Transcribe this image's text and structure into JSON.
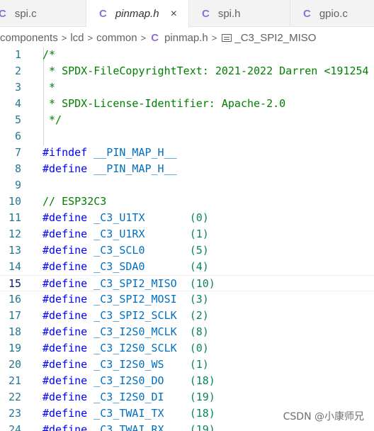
{
  "tabs": [
    {
      "icon": "C",
      "label": "spi.c",
      "active": false,
      "italic": false
    },
    {
      "icon": "C",
      "label": "pinmap.h",
      "active": true,
      "italic": true,
      "close": "×"
    },
    {
      "icon": "C",
      "label": "spi.h",
      "active": false,
      "italic": false
    },
    {
      "icon": "C",
      "label": "gpio.c",
      "active": false,
      "italic": false
    }
  ],
  "breadcrumb": {
    "parts": [
      "components",
      "lcd",
      "common"
    ],
    "file_icon": "C",
    "file": "pinmap.h",
    "symbol": "_C3_SPI2_MISO",
    "separator": ">"
  },
  "editor": {
    "current_line": 15,
    "lines": [
      {
        "n": "1",
        "tokens": [
          {
            "t": "/*",
            "k": "comment"
          }
        ]
      },
      {
        "n": "2",
        "tokens": [
          {
            "t": " * SPDX-FileCopyrightText: 2021-2022 Darren <191254",
            "k": "comment"
          }
        ]
      },
      {
        "n": "3",
        "tokens": [
          {
            "t": " *",
            "k": "comment"
          }
        ]
      },
      {
        "n": "4",
        "tokens": [
          {
            "t": " * SPDX-License-Identifier: Apache-2.0",
            "k": "comment"
          }
        ]
      },
      {
        "n": "5",
        "tokens": [
          {
            "t": " */",
            "k": "comment"
          }
        ]
      },
      {
        "n": "6",
        "tokens": []
      },
      {
        "n": "7",
        "tokens": [
          {
            "t": "#ifndef",
            "k": "kw"
          },
          {
            "t": " __PIN_MAP_H__",
            "k": "ident"
          }
        ]
      },
      {
        "n": "8",
        "tokens": [
          {
            "t": "#define",
            "k": "kw"
          },
          {
            "t": " __PIN_MAP_H__",
            "k": "ident"
          }
        ]
      },
      {
        "n": "9",
        "tokens": []
      },
      {
        "n": "10",
        "tokens": [
          {
            "t": "// ESP32C3",
            "k": "comment"
          }
        ]
      },
      {
        "n": "11",
        "tokens": [
          {
            "t": "#define",
            "k": "kw"
          },
          {
            "t": " _C3_U1TX       ",
            "k": "ident"
          },
          {
            "t": "(0)",
            "k": "num"
          }
        ]
      },
      {
        "n": "12",
        "tokens": [
          {
            "t": "#define",
            "k": "kw"
          },
          {
            "t": " _C3_U1RX       ",
            "k": "ident"
          },
          {
            "t": "(1)",
            "k": "num"
          }
        ]
      },
      {
        "n": "13",
        "tokens": [
          {
            "t": "#define",
            "k": "kw"
          },
          {
            "t": " _C3_SCL0       ",
            "k": "ident"
          },
          {
            "t": "(5)",
            "k": "num"
          }
        ]
      },
      {
        "n": "14",
        "tokens": [
          {
            "t": "#define",
            "k": "kw"
          },
          {
            "t": " _C3_SDA0       ",
            "k": "ident"
          },
          {
            "t": "(4)",
            "k": "num"
          }
        ]
      },
      {
        "n": "15",
        "tokens": [
          {
            "t": "#define",
            "k": "kw"
          },
          {
            "t": " _C3_SPI2_MISO  ",
            "k": "ident"
          },
          {
            "t": "(10)",
            "k": "num"
          }
        ]
      },
      {
        "n": "16",
        "tokens": [
          {
            "t": "#define",
            "k": "kw"
          },
          {
            "t": " _C3_SPI2_MOSI  ",
            "k": "ident"
          },
          {
            "t": "(3)",
            "k": "num"
          }
        ]
      },
      {
        "n": "17",
        "tokens": [
          {
            "t": "#define",
            "k": "kw"
          },
          {
            "t": " _C3_SPI2_SCLK  ",
            "k": "ident"
          },
          {
            "t": "(2)",
            "k": "num"
          }
        ]
      },
      {
        "n": "18",
        "tokens": [
          {
            "t": "#define",
            "k": "kw"
          },
          {
            "t": " _C3_I2S0_MCLK  ",
            "k": "ident"
          },
          {
            "t": "(8)",
            "k": "num"
          }
        ]
      },
      {
        "n": "19",
        "tokens": [
          {
            "t": "#define",
            "k": "kw"
          },
          {
            "t": " _C3_I2S0_SCLK  ",
            "k": "ident"
          },
          {
            "t": "(0)",
            "k": "num"
          }
        ]
      },
      {
        "n": "20",
        "tokens": [
          {
            "t": "#define",
            "k": "kw"
          },
          {
            "t": " _C3_I2S0_WS    ",
            "k": "ident"
          },
          {
            "t": "(1)",
            "k": "num"
          }
        ]
      },
      {
        "n": "21",
        "tokens": [
          {
            "t": "#define",
            "k": "kw"
          },
          {
            "t": " _C3_I2S0_DO    ",
            "k": "ident"
          },
          {
            "t": "(18)",
            "k": "num"
          }
        ]
      },
      {
        "n": "22",
        "tokens": [
          {
            "t": "#define",
            "k": "kw"
          },
          {
            "t": " _C3_I2S0_DI    ",
            "k": "ident"
          },
          {
            "t": "(19)",
            "k": "num"
          }
        ]
      },
      {
        "n": "23",
        "tokens": [
          {
            "t": "#define",
            "k": "kw"
          },
          {
            "t": " _C3_TWAI_TX    ",
            "k": "ident"
          },
          {
            "t": "(18)",
            "k": "num"
          }
        ]
      },
      {
        "n": "24",
        "tokens": [
          {
            "t": "#define",
            "k": "kw"
          },
          {
            "t": " _C3_TWAI_RX    ",
            "k": "ident"
          },
          {
            "t": "(19)",
            "k": "num"
          }
        ]
      }
    ]
  },
  "watermark": "CSDN @小康师兄",
  "colors": {
    "c_icon": "#8e6fd6",
    "comment": "#008000",
    "keyword": "#0000ff",
    "identifier": "#0070c1",
    "number": "#098658",
    "line_number": "#237893"
  }
}
